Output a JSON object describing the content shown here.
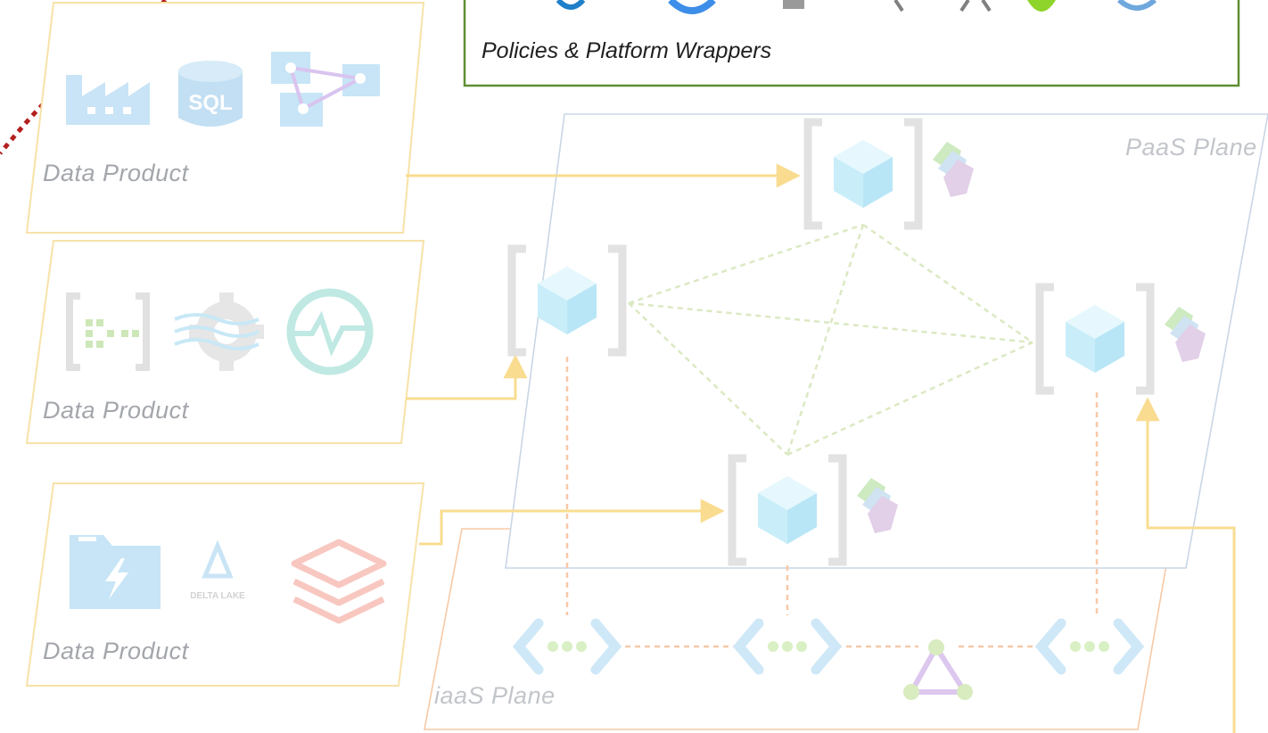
{
  "policies_box": {
    "caption": "Policies & Platform Wrappers",
    "border_color": "#5e8f34"
  },
  "upper_plane": {
    "label": "PaaS Plane"
  },
  "lower_plane": {
    "label": "iaaS Plane"
  },
  "data_products": [
    {
      "label": "Data Product",
      "icons": [
        "factory-icon",
        "sql-database-icon",
        "data-network-icon"
      ]
    },
    {
      "label": "Data Product",
      "icons": [
        "event-hub-icon",
        "stream-gear-icon",
        "monitor-pulse-icon"
      ]
    },
    {
      "label": "Data Product",
      "icons": [
        "data-lake-folder-icon",
        "delta-lake-logo",
        "databricks-layers-icon"
      ]
    }
  ],
  "delta_lake_text": "DELTA LAKE",
  "sql_text": "SQL",
  "colors": {
    "data_product_border": "#f7e2a8",
    "arrow": "#f9dc90",
    "upper_plane_border": "#c9d6e6",
    "lower_plane_border": "#f6c9a6",
    "mesh_line": "#dbe9c2",
    "vertical_dash": "#f7c8a8",
    "red_dotted": "#b3201f"
  }
}
